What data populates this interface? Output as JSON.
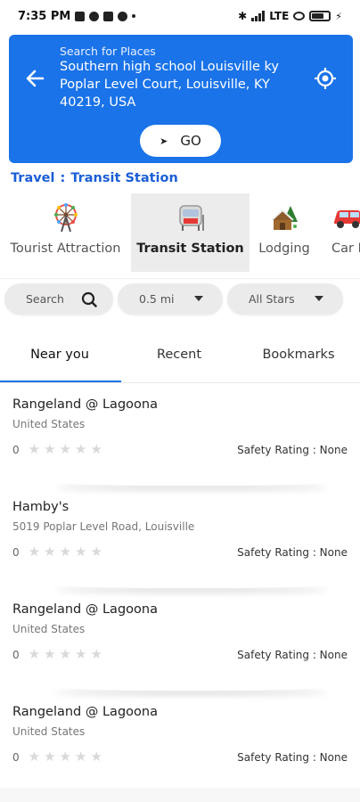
{
  "status_bar": {
    "time": "7:35 PM",
    "network": "LTE"
  },
  "search": {
    "label": "Search for Places",
    "value": "Southern high school Louisville ky Poplar Level Court, Louisville, KY 40219, USA",
    "go_label": "GO",
    "back_icon": "arrow-left-icon",
    "locate_icon": "my-location-icon"
  },
  "breadcrumb": {
    "section": "Travel",
    "separator": ":",
    "current": "Transit Station"
  },
  "categories": [
    {
      "label": "Tourist Attraction",
      "icon": "ferris-wheel-icon",
      "active": false
    },
    {
      "label": "Transit Station",
      "icon": "train-station-icon",
      "active": true
    },
    {
      "label": "Lodging",
      "icon": "cabin-icon",
      "active": false
    },
    {
      "label": "Car R",
      "icon": "car-icon",
      "active": false
    }
  ],
  "filters": {
    "search_label": "Search",
    "distance": "0.5 mi",
    "stars": "All Stars"
  },
  "tabs": [
    {
      "label": "Near you",
      "active": true
    },
    {
      "label": "Recent",
      "active": false
    },
    {
      "label": "Bookmarks",
      "active": false
    }
  ],
  "places": [
    {
      "name": "Rangeland @ Lagoona",
      "address": "United States",
      "rating": "0",
      "safety": "Safety Rating : None"
    },
    {
      "name": "Hamby's",
      "address": "5019 Poplar Level Road, Louisville",
      "rating": "0",
      "safety": "Safety Rating : None"
    },
    {
      "name": "Rangeland @ Lagoona",
      "address": "United States",
      "rating": "0",
      "safety": "Safety Rating : None"
    },
    {
      "name": "Rangeland @ Lagoona",
      "address": "United States",
      "rating": "0",
      "safety": "Safety Rating : None"
    }
  ],
  "colors": {
    "accent": "#1a73e8",
    "breadcrumb": "#1a5fd6",
    "chip_bg": "#ebebeb",
    "active_category_bg": "#ececec"
  }
}
